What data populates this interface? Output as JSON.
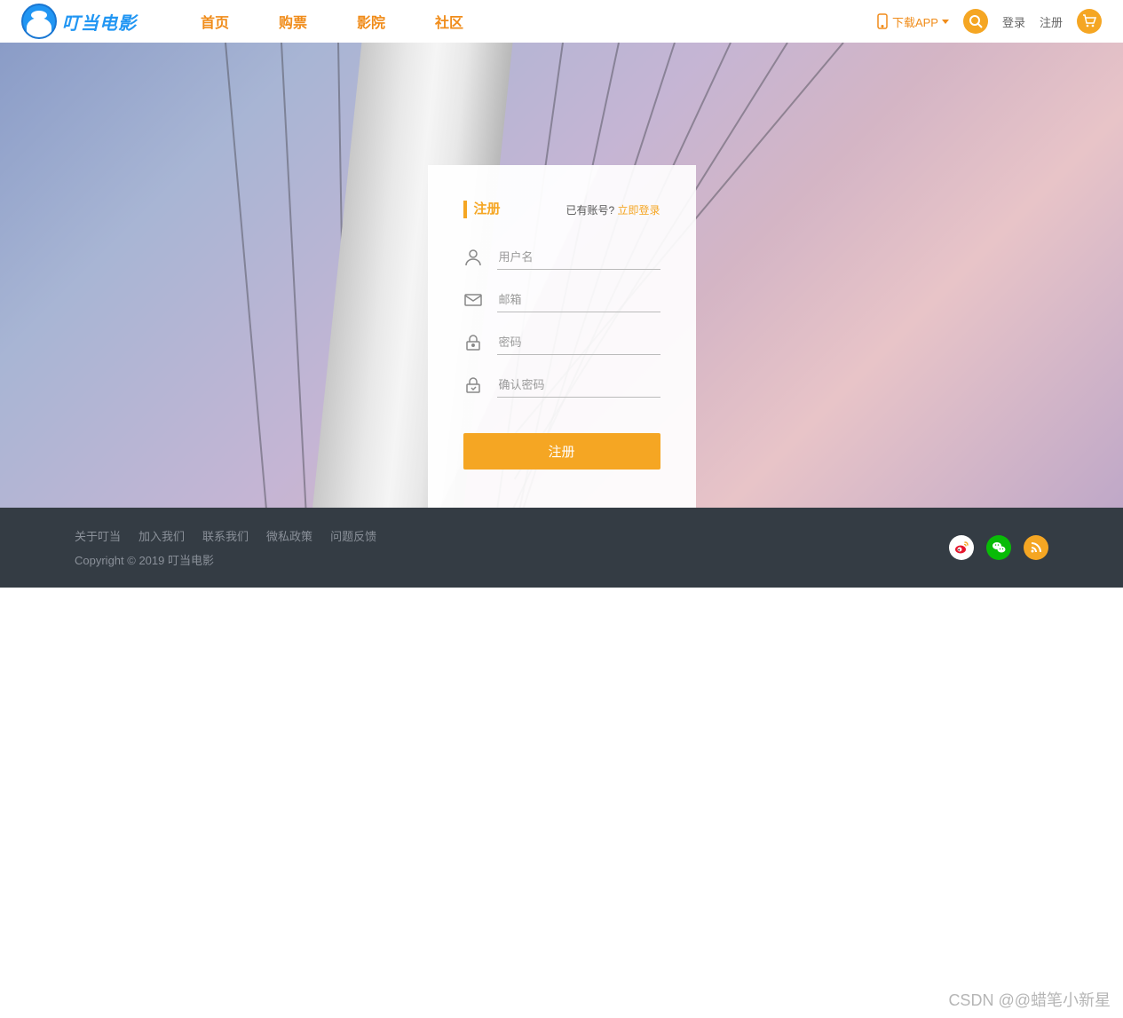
{
  "header": {
    "brand": "叮当电影",
    "nav": [
      "首页",
      "购票",
      "影院",
      "社区"
    ],
    "download": "下载APP",
    "login": "登录",
    "register": "注册"
  },
  "card": {
    "title": "注册",
    "hasAccount": "已有账号?",
    "loginNow": "立即登录",
    "placeholders": {
      "username": "用户名",
      "email": "邮箱",
      "password": "密码",
      "confirm": "确认密码"
    },
    "submit": "注册"
  },
  "footer": {
    "links": [
      "关于叮当",
      "加入我们",
      "联系我们",
      "微私政策",
      "问题反馈"
    ],
    "copyright": "Copyright © 2019 叮当电影"
  },
  "watermark": "CSDN @@蜡笔小新星"
}
